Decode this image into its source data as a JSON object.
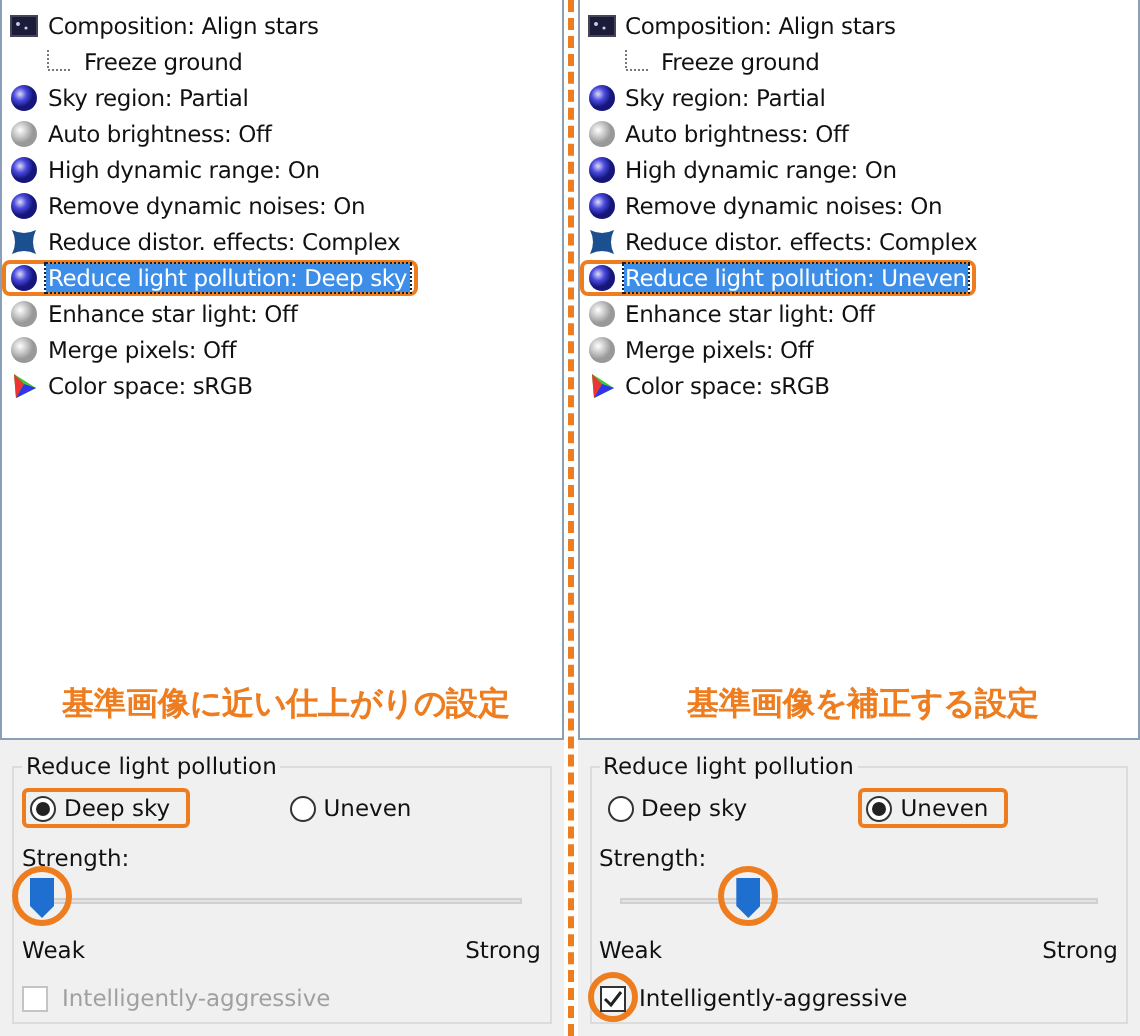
{
  "panels": [
    {
      "items": [
        {
          "label": "Composition: Align stars",
          "kind": "composition",
          "selected": false,
          "highlighted": false,
          "children": [
            {
              "label": "Freeze ground",
              "kind": "child",
              "selected": false,
              "highlighted": false
            }
          ]
        },
        {
          "label": "Sky region: Partial",
          "kind": "on",
          "selected": false,
          "highlighted": false
        },
        {
          "label": "Auto brightness: Off",
          "kind": "off",
          "selected": false,
          "highlighted": false
        },
        {
          "label": "High dynamic range: On",
          "kind": "on",
          "selected": false,
          "highlighted": false
        },
        {
          "label": "Remove dynamic noises: On",
          "kind": "on",
          "selected": false,
          "highlighted": false
        },
        {
          "label": "Reduce distor. effects: Complex",
          "kind": "distortion",
          "selected": false,
          "highlighted": false
        },
        {
          "label": "Reduce light pollution: Deep sky",
          "kind": "on",
          "selected": true,
          "highlighted": true
        },
        {
          "label": "Enhance star light: Off",
          "kind": "off",
          "selected": false,
          "highlighted": false
        },
        {
          "label": "Merge pixels: Off",
          "kind": "off",
          "selected": false,
          "highlighted": false
        },
        {
          "label": "Color space: sRGB",
          "kind": "colorspace",
          "selected": false,
          "highlighted": false
        }
      ],
      "caption": "基準画像に近い仕上がりの設定",
      "group": {
        "title": "Reduce light pollution",
        "options": [
          {
            "label": "Deep sky",
            "selected": true,
            "highlighted": true
          },
          {
            "label": "Uneven",
            "selected": false,
            "highlighted": false
          }
        ],
        "strength_label": "Strength:",
        "level": 0.0,
        "slider_circled": true,
        "min_label": "Weak",
        "max_label": "Strong",
        "checkbox": {
          "label": "Intelligently-aggressive",
          "checked": false,
          "disabled": true,
          "circled": false
        }
      }
    },
    {
      "items": [
        {
          "label": "Composition: Align stars",
          "kind": "composition",
          "selected": false,
          "highlighted": false,
          "children": [
            {
              "label": "Freeze ground",
              "kind": "child",
              "selected": false,
              "highlighted": false
            }
          ]
        },
        {
          "label": "Sky region: Partial",
          "kind": "on",
          "selected": false,
          "highlighted": false
        },
        {
          "label": "Auto brightness: Off",
          "kind": "off",
          "selected": false,
          "highlighted": false
        },
        {
          "label": "High dynamic range: On",
          "kind": "on",
          "selected": false,
          "highlighted": false
        },
        {
          "label": "Remove dynamic noises: On",
          "kind": "on",
          "selected": false,
          "highlighted": false
        },
        {
          "label": "Reduce distor. effects: Complex",
          "kind": "distortion",
          "selected": false,
          "highlighted": false
        },
        {
          "label": "Reduce light pollution: Uneven",
          "kind": "on",
          "selected": true,
          "highlighted": true
        },
        {
          "label": "Enhance star light: Off",
          "kind": "off",
          "selected": false,
          "highlighted": false
        },
        {
          "label": "Merge pixels: Off",
          "kind": "off",
          "selected": false,
          "highlighted": false
        },
        {
          "label": "Color space: sRGB",
          "kind": "colorspace",
          "selected": false,
          "highlighted": false
        }
      ],
      "caption": "基準画像を補正する設定",
      "group": {
        "title": "Reduce light pollution",
        "options": [
          {
            "label": "Deep sky",
            "selected": false,
            "highlighted": false
          },
          {
            "label": "Uneven",
            "selected": true,
            "highlighted": true
          }
        ],
        "strength_label": "Strength:",
        "level": 0.27,
        "slider_circled": true,
        "min_label": "Weak",
        "max_label": "Strong",
        "checkbox": {
          "label": "Intelligently-aggressive",
          "checked": true,
          "disabled": false,
          "circled": true
        }
      }
    }
  ]
}
